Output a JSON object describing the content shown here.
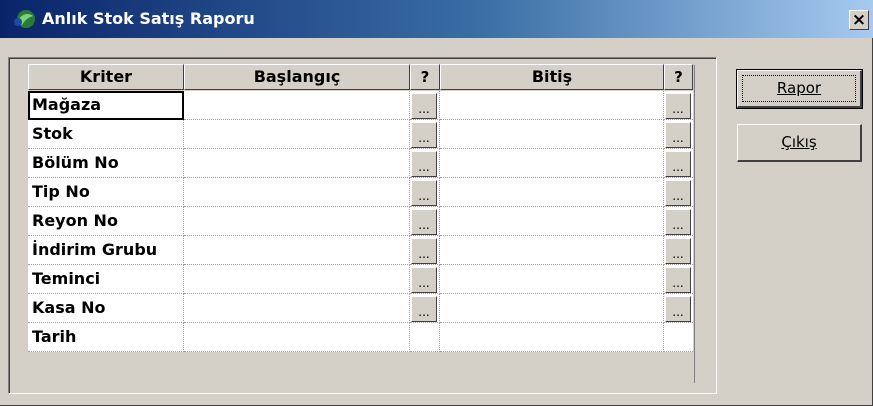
{
  "window": {
    "title": "Anlık Stok Satış Raporu",
    "close_glyph": "×",
    "icon": "app-icon"
  },
  "grid": {
    "headers": {
      "criteria": "Kriter",
      "start": "Başlangıç",
      "q1": "?",
      "end": "Bitiş",
      "q2": "?"
    },
    "ellipsis": "...",
    "rows": [
      {
        "label": "Mağaza",
        "start": "",
        "end": "",
        "has_lookup": true
      },
      {
        "label": "Stok",
        "start": "",
        "end": "",
        "has_lookup": true
      },
      {
        "label": "Bölüm No",
        "start": "",
        "end": "",
        "has_lookup": true
      },
      {
        "label": "Tip No",
        "start": "",
        "end": "",
        "has_lookup": true
      },
      {
        "label": "Reyon No",
        "start": "",
        "end": "",
        "has_lookup": true
      },
      {
        "label": "İndirim Grubu",
        "start": "",
        "end": "",
        "has_lookup": true
      },
      {
        "label": "Teminci",
        "start": "",
        "end": "",
        "has_lookup": true
      },
      {
        "label": "Kasa No",
        "start": "",
        "end": "",
        "has_lookup": true
      },
      {
        "label": "Tarih",
        "start": "",
        "end": "",
        "has_lookup": false
      }
    ]
  },
  "buttons": {
    "report": "Rapor",
    "exit": "Çıkış"
  }
}
